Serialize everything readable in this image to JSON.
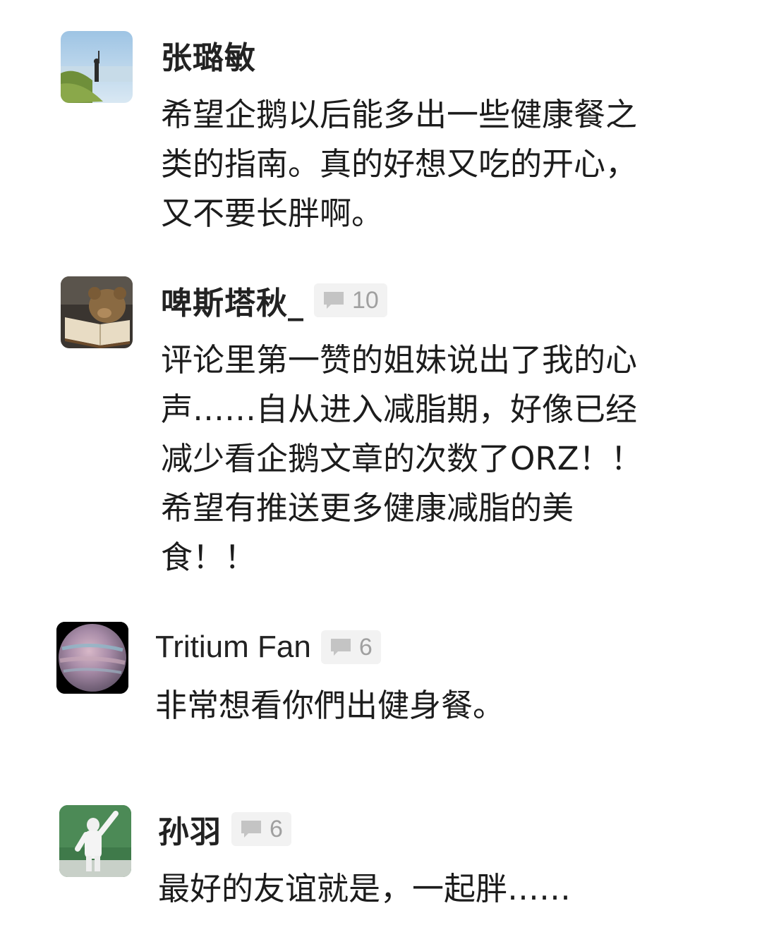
{
  "comments": [
    {
      "author": "张璐敏",
      "reply_count": "",
      "lines": [
        "希望企鹅以后能多出一些健康餐之",
        "类的指南。真的好想又吃的开心，",
        "又不要长胖啊。"
      ],
      "avatar_icon": "person-by-lake-avatar"
    },
    {
      "author": "啤斯塔秋_",
      "reply_count": "10",
      "lines": [
        "评论里第一赞的姐妹说出了我的心",
        "声……自从进入减脂期，好像已经",
        "减少看企鹅文章的次数了ORZ！！",
        "希望有推送更多健康减脂的美",
        "食！！"
      ],
      "avatar_icon": "teddy-bear-book-avatar"
    },
    {
      "author": "Tritium Fan",
      "reply_count": "6",
      "lines": [
        "非常想看你們出健身餐。"
      ],
      "avatar_icon": "planet-avatar"
    },
    {
      "author": "孙羽",
      "reply_count": "6",
      "lines": [
        "最好的友谊就是，一起胖……"
      ],
      "avatar_icon": "hazmat-suit-avatar"
    }
  ],
  "colors": {
    "badge_bg": "#f2f2f2",
    "badge_text": "#a0a0a0",
    "text": "#1c1c1c"
  }
}
